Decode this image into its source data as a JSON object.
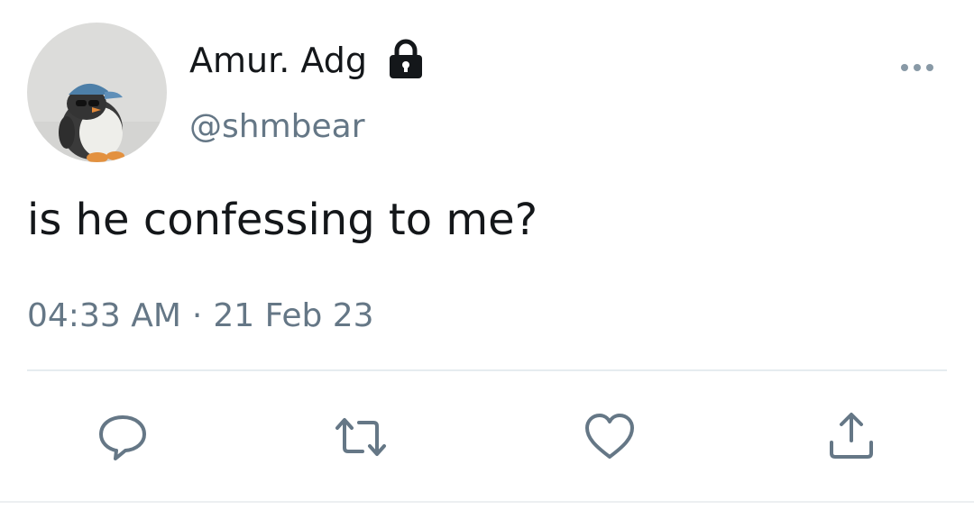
{
  "tweet": {
    "author": {
      "display_name": "Amur. Adg",
      "handle": "@shmbear",
      "protected": true,
      "avatar": "penguin-plush-with-blue-cap"
    },
    "text": "is he confessing to me?",
    "time": "04:33 AM",
    "separator": "·",
    "date": "21 Feb 23",
    "actions": [
      {
        "name": "reply",
        "icon": "reply-icon"
      },
      {
        "name": "retweet",
        "icon": "retweet-icon"
      },
      {
        "name": "like",
        "icon": "heart-icon"
      },
      {
        "name": "share",
        "icon": "share-icon"
      }
    ],
    "more_icon": "more-horizontal-icon"
  },
  "colors": {
    "primary_text": "#14171a",
    "secondary_text": "#657786",
    "divider": "#e6ecf0"
  }
}
